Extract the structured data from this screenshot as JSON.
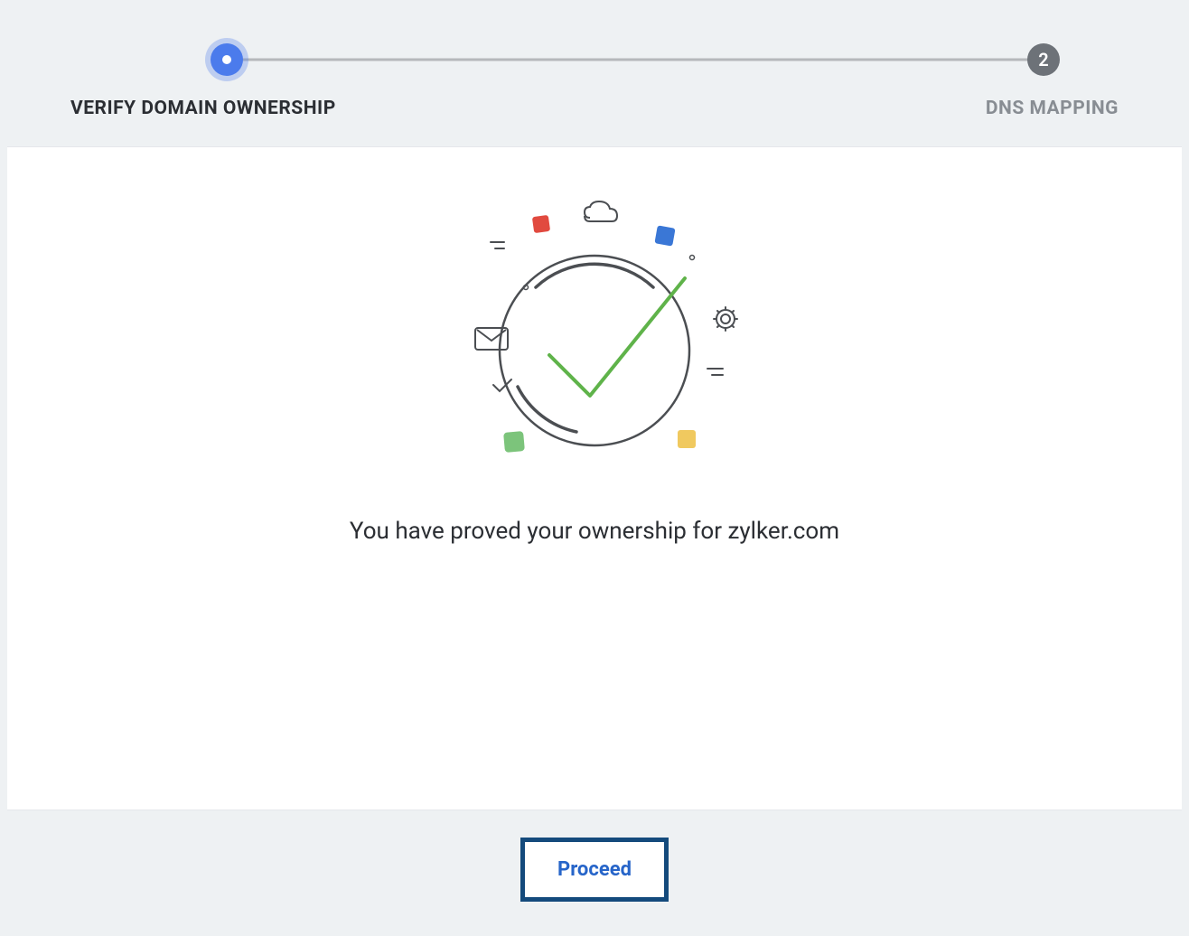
{
  "stepper": {
    "step1": {
      "label": "VERIFY DOMAIN OWNERSHIP"
    },
    "step2": {
      "number": "2",
      "label": "DNS MAPPING"
    }
  },
  "main": {
    "success_message": "You have proved your ownership for zylker.com"
  },
  "footer": {
    "proceed_label": "Proceed"
  },
  "colors": {
    "accent": "#4b7bec",
    "button_border": "#144a7c",
    "button_text": "#2765c9",
    "text_dark": "#2b2e33",
    "text_muted": "#888d93"
  }
}
